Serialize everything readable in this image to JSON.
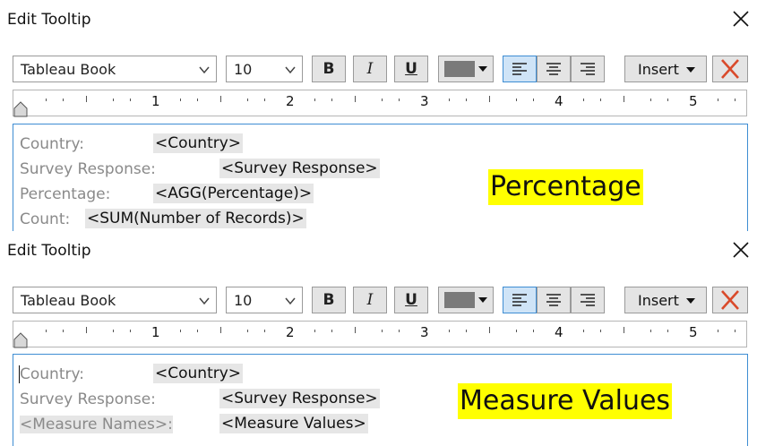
{
  "dialogs": [
    {
      "title": "Edit Tooltip",
      "font": "Tableau Book",
      "size": "10",
      "bold_label": "B",
      "italic_label": "I",
      "underline_label": "U",
      "insert_label": "Insert",
      "ruler": [
        "1",
        "2",
        "3",
        "4",
        "5"
      ],
      "lines": [
        {
          "label": "Country:",
          "field": "<Country>"
        },
        {
          "label": "Survey Response:",
          "field": "<Survey Response>"
        },
        {
          "label": "Percentage:",
          "field": "<AGG(Percentage)>"
        },
        {
          "label": "Count:",
          "field": "<SUM(Number of Records)>"
        }
      ],
      "highlight": "Percentage"
    },
    {
      "title": "Edit Tooltip",
      "font": "Tableau Book",
      "size": "10",
      "bold_label": "B",
      "italic_label": "I",
      "underline_label": "U",
      "insert_label": "Insert",
      "ruler": [
        "1",
        "2",
        "3",
        "4",
        "5"
      ],
      "lines": [
        {
          "label": "Country:",
          "field": "<Country>"
        },
        {
          "label": "Survey Response:",
          "field": "<Survey Response>"
        },
        {
          "label": "<Measure Names>:",
          "field": "<Measure Values>"
        }
      ],
      "highlight": "Measure Values"
    }
  ],
  "colors": {
    "accent": "#3e8dd3",
    "highlight": "#ffff00",
    "clear": "#d94a2b"
  }
}
